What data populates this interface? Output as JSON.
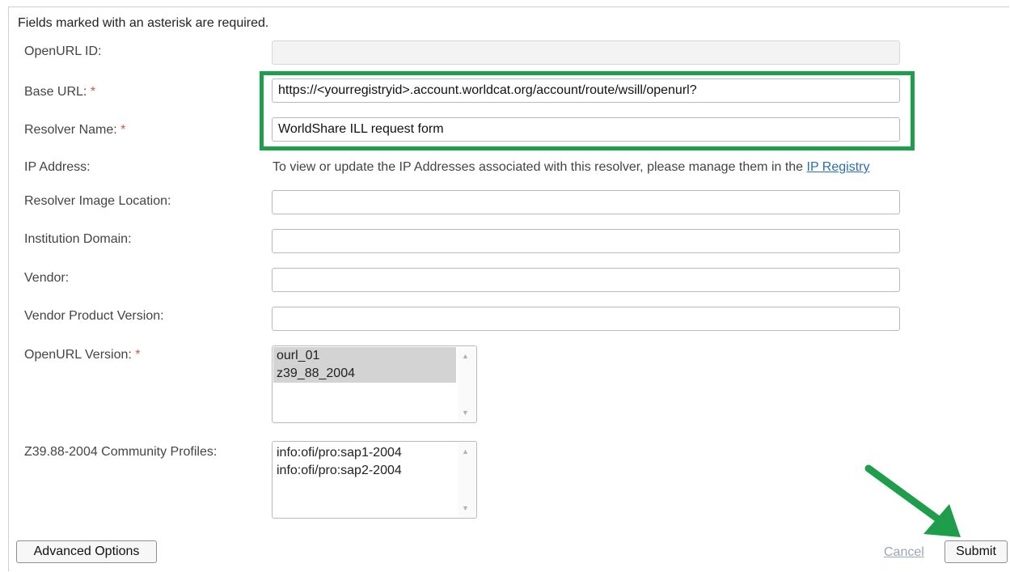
{
  "intro": "Fields marked with an asterisk are required.",
  "required_mark": "*",
  "labels": {
    "openurl_id": "OpenURL ID:",
    "base_url": "Base URL:",
    "resolver_name": "Resolver Name:",
    "ip_address": "IP Address:",
    "resolver_image": "Resolver Image Location:",
    "institution_domain": "Institution Domain:",
    "vendor": "Vendor:",
    "vendor_version": "Vendor Product Version:",
    "openurl_version": "OpenURL Version:",
    "community_profiles": "Z39.88-2004 Community Profiles:"
  },
  "fields": {
    "openurl_id": "",
    "base_url": "https://<yourregistryid>.account.worldcat.org/account/route/wsill/openurl?",
    "resolver_name": "WorldShare ILL request form",
    "resolver_image": "",
    "institution_domain": "",
    "vendor": "",
    "vendor_version": ""
  },
  "ip_note": {
    "text": "To view or update the IP Addresses associated with this resolver, please manage them in the ",
    "link": "IP Registry"
  },
  "openurl_version_options": [
    {
      "label": "ourl_01",
      "selected": true
    },
    {
      "label": "z39_88_2004",
      "selected": true
    }
  ],
  "community_profile_options": [
    {
      "label": "info:ofi/pro:sap1-2004",
      "selected": false
    },
    {
      "label": "info:ofi/pro:sap2-2004",
      "selected": false
    }
  ],
  "buttons": {
    "advanced": "Advanced Options",
    "cancel": "Cancel",
    "submit": "Submit"
  },
  "colors": {
    "highlight": "#1e9e4a",
    "required": "#d9534f",
    "link": "#2a6db8"
  },
  "icons": {
    "scroll_up": "▲",
    "scroll_down": "▼",
    "annotation_arrow": "arrow-icon"
  }
}
